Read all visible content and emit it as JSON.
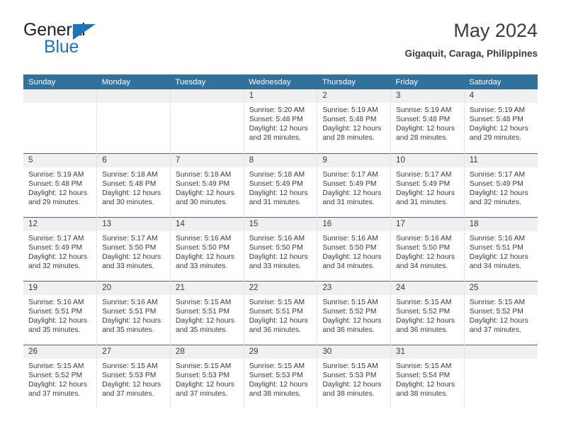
{
  "brand": {
    "name_top": "General",
    "name_bottom": "Blue",
    "accent_color": "#1b75bb",
    "triangle_icon": "triangle-icon"
  },
  "header": {
    "title": "May 2024",
    "subtitle": "Gigaquit, Caraga, Philippines"
  },
  "theme": {
    "header_row_color": "#31719b",
    "row_separator_color": "#31719b",
    "daynum_band_color": "#f0f0f0",
    "text_color": "#3b3b3b"
  },
  "labels": {
    "sunrise_prefix": "Sunrise:",
    "sunset_prefix": "Sunset:",
    "daylight_prefix": "Daylight:"
  },
  "columns": [
    "Sunday",
    "Monday",
    "Tuesday",
    "Wednesday",
    "Thursday",
    "Friday",
    "Saturday"
  ],
  "weeks": [
    [
      {
        "empty": true
      },
      {
        "empty": true
      },
      {
        "empty": true
      },
      {
        "day": "1",
        "sunrise": "Sunrise: 5:20 AM",
        "sunset": "Sunset: 5:48 PM",
        "daylight_1": "Daylight: 12 hours",
        "daylight_2": "and 28 minutes."
      },
      {
        "day": "2",
        "sunrise": "Sunrise: 5:19 AM",
        "sunset": "Sunset: 5:48 PM",
        "daylight_1": "Daylight: 12 hours",
        "daylight_2": "and 28 minutes."
      },
      {
        "day": "3",
        "sunrise": "Sunrise: 5:19 AM",
        "sunset": "Sunset: 5:48 PM",
        "daylight_1": "Daylight: 12 hours",
        "daylight_2": "and 28 minutes."
      },
      {
        "day": "4",
        "sunrise": "Sunrise: 5:19 AM",
        "sunset": "Sunset: 5:48 PM",
        "daylight_1": "Daylight: 12 hours",
        "daylight_2": "and 29 minutes."
      }
    ],
    [
      {
        "day": "5",
        "sunrise": "Sunrise: 5:19 AM",
        "sunset": "Sunset: 5:48 PM",
        "daylight_1": "Daylight: 12 hours",
        "daylight_2": "and 29 minutes."
      },
      {
        "day": "6",
        "sunrise": "Sunrise: 5:18 AM",
        "sunset": "Sunset: 5:48 PM",
        "daylight_1": "Daylight: 12 hours",
        "daylight_2": "and 30 minutes."
      },
      {
        "day": "7",
        "sunrise": "Sunrise: 5:18 AM",
        "sunset": "Sunset: 5:49 PM",
        "daylight_1": "Daylight: 12 hours",
        "daylight_2": "and 30 minutes."
      },
      {
        "day": "8",
        "sunrise": "Sunrise: 5:18 AM",
        "sunset": "Sunset: 5:49 PM",
        "daylight_1": "Daylight: 12 hours",
        "daylight_2": "and 31 minutes."
      },
      {
        "day": "9",
        "sunrise": "Sunrise: 5:17 AM",
        "sunset": "Sunset: 5:49 PM",
        "daylight_1": "Daylight: 12 hours",
        "daylight_2": "and 31 minutes."
      },
      {
        "day": "10",
        "sunrise": "Sunrise: 5:17 AM",
        "sunset": "Sunset: 5:49 PM",
        "daylight_1": "Daylight: 12 hours",
        "daylight_2": "and 31 minutes."
      },
      {
        "day": "11",
        "sunrise": "Sunrise: 5:17 AM",
        "sunset": "Sunset: 5:49 PM",
        "daylight_1": "Daylight: 12 hours",
        "daylight_2": "and 32 minutes."
      }
    ],
    [
      {
        "day": "12",
        "sunrise": "Sunrise: 5:17 AM",
        "sunset": "Sunset: 5:49 PM",
        "daylight_1": "Daylight: 12 hours",
        "daylight_2": "and 32 minutes."
      },
      {
        "day": "13",
        "sunrise": "Sunrise: 5:17 AM",
        "sunset": "Sunset: 5:50 PM",
        "daylight_1": "Daylight: 12 hours",
        "daylight_2": "and 33 minutes."
      },
      {
        "day": "14",
        "sunrise": "Sunrise: 5:16 AM",
        "sunset": "Sunset: 5:50 PM",
        "daylight_1": "Daylight: 12 hours",
        "daylight_2": "and 33 minutes."
      },
      {
        "day": "15",
        "sunrise": "Sunrise: 5:16 AM",
        "sunset": "Sunset: 5:50 PM",
        "daylight_1": "Daylight: 12 hours",
        "daylight_2": "and 33 minutes."
      },
      {
        "day": "16",
        "sunrise": "Sunrise: 5:16 AM",
        "sunset": "Sunset: 5:50 PM",
        "daylight_1": "Daylight: 12 hours",
        "daylight_2": "and 34 minutes."
      },
      {
        "day": "17",
        "sunrise": "Sunrise: 5:16 AM",
        "sunset": "Sunset: 5:50 PM",
        "daylight_1": "Daylight: 12 hours",
        "daylight_2": "and 34 minutes."
      },
      {
        "day": "18",
        "sunrise": "Sunrise: 5:16 AM",
        "sunset": "Sunset: 5:51 PM",
        "daylight_1": "Daylight: 12 hours",
        "daylight_2": "and 34 minutes."
      }
    ],
    [
      {
        "day": "19",
        "sunrise": "Sunrise: 5:16 AM",
        "sunset": "Sunset: 5:51 PM",
        "daylight_1": "Daylight: 12 hours",
        "daylight_2": "and 35 minutes."
      },
      {
        "day": "20",
        "sunrise": "Sunrise: 5:16 AM",
        "sunset": "Sunset: 5:51 PM",
        "daylight_1": "Daylight: 12 hours",
        "daylight_2": "and 35 minutes."
      },
      {
        "day": "21",
        "sunrise": "Sunrise: 5:15 AM",
        "sunset": "Sunset: 5:51 PM",
        "daylight_1": "Daylight: 12 hours",
        "daylight_2": "and 35 minutes."
      },
      {
        "day": "22",
        "sunrise": "Sunrise: 5:15 AM",
        "sunset": "Sunset: 5:51 PM",
        "daylight_1": "Daylight: 12 hours",
        "daylight_2": "and 36 minutes."
      },
      {
        "day": "23",
        "sunrise": "Sunrise: 5:15 AM",
        "sunset": "Sunset: 5:52 PM",
        "daylight_1": "Daylight: 12 hours",
        "daylight_2": "and 36 minutes."
      },
      {
        "day": "24",
        "sunrise": "Sunrise: 5:15 AM",
        "sunset": "Sunset: 5:52 PM",
        "daylight_1": "Daylight: 12 hours",
        "daylight_2": "and 36 minutes."
      },
      {
        "day": "25",
        "sunrise": "Sunrise: 5:15 AM",
        "sunset": "Sunset: 5:52 PM",
        "daylight_1": "Daylight: 12 hours",
        "daylight_2": "and 37 minutes."
      }
    ],
    [
      {
        "day": "26",
        "sunrise": "Sunrise: 5:15 AM",
        "sunset": "Sunset: 5:52 PM",
        "daylight_1": "Daylight: 12 hours",
        "daylight_2": "and 37 minutes."
      },
      {
        "day": "27",
        "sunrise": "Sunrise: 5:15 AM",
        "sunset": "Sunset: 5:53 PM",
        "daylight_1": "Daylight: 12 hours",
        "daylight_2": "and 37 minutes."
      },
      {
        "day": "28",
        "sunrise": "Sunrise: 5:15 AM",
        "sunset": "Sunset: 5:53 PM",
        "daylight_1": "Daylight: 12 hours",
        "daylight_2": "and 37 minutes."
      },
      {
        "day": "29",
        "sunrise": "Sunrise: 5:15 AM",
        "sunset": "Sunset: 5:53 PM",
        "daylight_1": "Daylight: 12 hours",
        "daylight_2": "and 38 minutes."
      },
      {
        "day": "30",
        "sunrise": "Sunrise: 5:15 AM",
        "sunset": "Sunset: 5:53 PM",
        "daylight_1": "Daylight: 12 hours",
        "daylight_2": "and 38 minutes."
      },
      {
        "day": "31",
        "sunrise": "Sunrise: 5:15 AM",
        "sunset": "Sunset: 5:54 PM",
        "daylight_1": "Daylight: 12 hours",
        "daylight_2": "and 38 minutes."
      },
      {
        "empty": true
      }
    ]
  ]
}
